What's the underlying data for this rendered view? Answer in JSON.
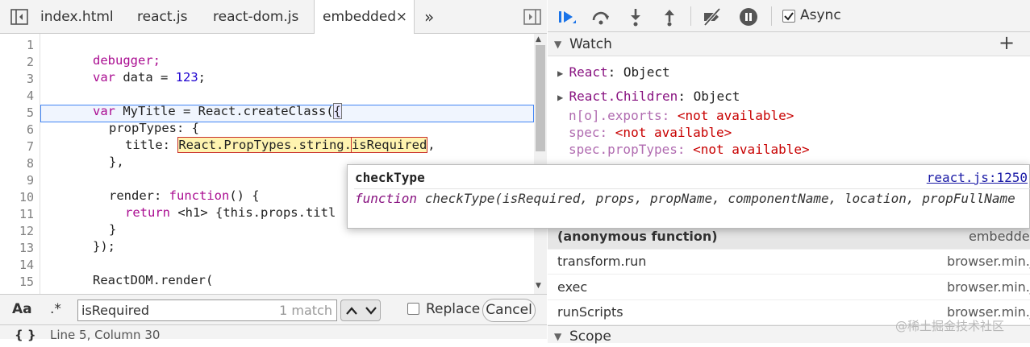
{
  "tabs": [
    "index.html",
    "react.js",
    "react-dom.js",
    "embedded"
  ],
  "tab_close": "×",
  "tab_more": "»",
  "code": {
    "line_numbers": [
      "1",
      "2",
      "3",
      "4",
      "5",
      "6",
      "7",
      "8",
      "9",
      "10",
      "11",
      "12",
      "13",
      "14",
      "15"
    ],
    "l2": "debugger;",
    "l3_kw": "var",
    "l3_mid": " data = ",
    "l3_num": "123",
    "l3_end": ";",
    "l5_kw": "var",
    "l5_rest": " MyTitle = React.createClass(",
    "l5_brace": "{",
    "l6": "propTypes: {",
    "l7_a": "title: ",
    "l7_b": "React.PropTypes.string.",
    "l7_c": "isRequired",
    "l7_d": ",",
    "l8": "},",
    "l10_a": "render: ",
    "l10_kw": "function",
    "l10_b": "() {",
    "l11_kw": "return",
    "l11_b": " <h1> {this.props.titl",
    "l12": "}",
    "l13": "});",
    "l15": "ReactDOM.render("
  },
  "search": {
    "case_toggle": "Aa",
    "regex_toggle": ".*",
    "value": "isRequired",
    "match_count": "1 match",
    "replace_label": "Replace",
    "cancel_label": "Cancel"
  },
  "status": {
    "brace_icon": "{ }",
    "position": "Line 5, Column 30"
  },
  "debugger": {
    "async_label": "Async"
  },
  "watch": {
    "title": "Watch",
    "add": "+",
    "items": [
      {
        "key": "React",
        "sep": ": ",
        "value": "Object"
      },
      {
        "key": "React.Children",
        "sep": ": ",
        "value": "Object"
      }
    ],
    "unavailable": [
      {
        "expr": "n[o].exports",
        "value": "<not available>"
      },
      {
        "expr": "spec",
        "value": "<not available>"
      },
      {
        "expr": "spec.propTypes",
        "value": "<not available>"
      }
    ]
  },
  "call_stack": [
    {
      "name": "(anonymous function)",
      "source": "embedded",
      "current": true
    },
    {
      "name": "transform.run",
      "source": "browser.min.js",
      "current": false
    },
    {
      "name": "exec",
      "source": "browser.min.js",
      "current": false
    },
    {
      "name": "runScripts",
      "source": "browser.min.js",
      "current": false
    }
  ],
  "scope_title": "Scope",
  "popover": {
    "title": "checkType",
    "link": "react.js:1250",
    "sig_kw": "function",
    "sig_rest": " checkType(isRequired, props, propName, componentName, location, propFullName"
  },
  "watermark": "@稀土掘金技术社区",
  "colors": {
    "accent": "#1a73e8",
    "highlight": "#fff4b0",
    "highlight_border": "#c9302c"
  }
}
